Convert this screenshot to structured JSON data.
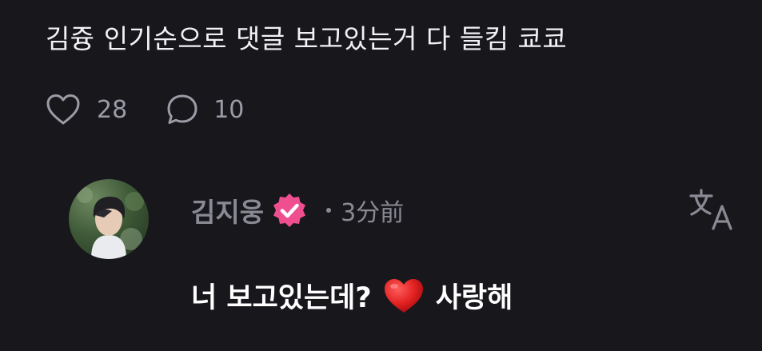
{
  "post": {
    "text": "김즁 인기순으로 댓글 보고있는거 다 들킴 쿄쿄",
    "likes": "28",
    "comments": "10",
    "like_icon": "heart-outline-icon",
    "comment_icon": "speech-bubble-icon"
  },
  "reply": {
    "author": "김지웅",
    "verified_icon": "verified-badge-icon",
    "verified_color": "#ef4f8e",
    "time": "3分前",
    "text_before": "너 보고있는데?",
    "emoji": "red-heart-emoji",
    "text_after": "사랑해",
    "translate_icon": "translate-icon"
  }
}
